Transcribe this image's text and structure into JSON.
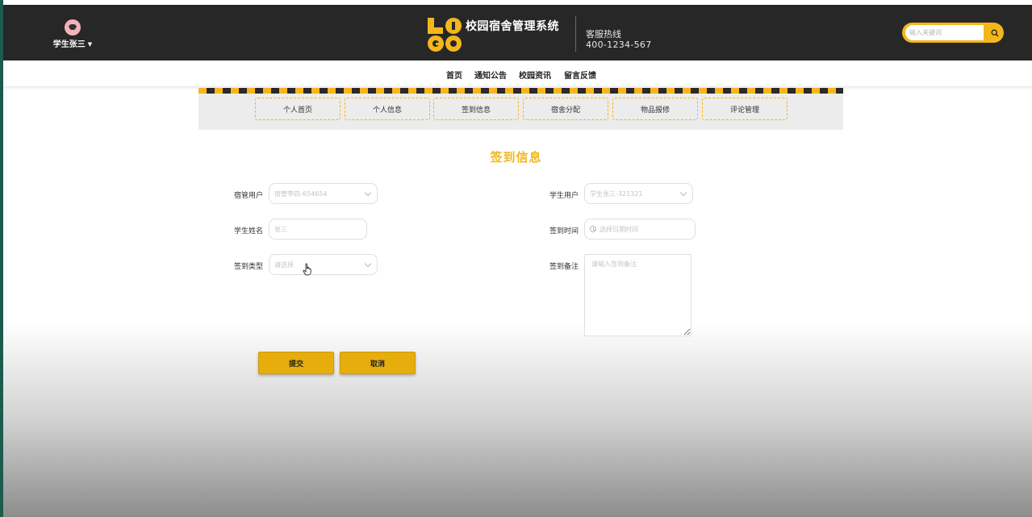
{
  "header": {
    "user_name": "学生张三",
    "site_title": "校园宿舍管理系统",
    "hotline_label": "客服热线",
    "hotline_number": "400-1234-567",
    "search_placeholder": "输入关键词",
    "accent_color": "#f3b71b"
  },
  "nav": {
    "items": [
      {
        "label": "首页"
      },
      {
        "label": "通知公告"
      },
      {
        "label": "校园资讯"
      },
      {
        "label": "留言反馈"
      }
    ]
  },
  "subnav": {
    "items": [
      {
        "label": "个人首页"
      },
      {
        "label": "个人信息"
      },
      {
        "label": "签到信息"
      },
      {
        "label": "宿舍分配"
      },
      {
        "label": "物品报修"
      },
      {
        "label": "评论管理"
      }
    ]
  },
  "form": {
    "title": "签到信息",
    "dorm_user_label": "宿管用户",
    "dorm_user_value": "宿管李四-654654",
    "student_user_label": "学生用户",
    "student_user_value": "学生张三-321321",
    "student_name_label": "学生姓名",
    "student_name_value": "张三",
    "checkin_time_label": "签到时间",
    "checkin_time_placeholder": "选择日期时间",
    "checkin_type_label": "签到类型",
    "checkin_type_placeholder": "请选择",
    "checkin_note_label": "签到备注",
    "checkin_note_placeholder": "请输入签到备注",
    "submit_label": "提交",
    "cancel_label": "取消"
  }
}
